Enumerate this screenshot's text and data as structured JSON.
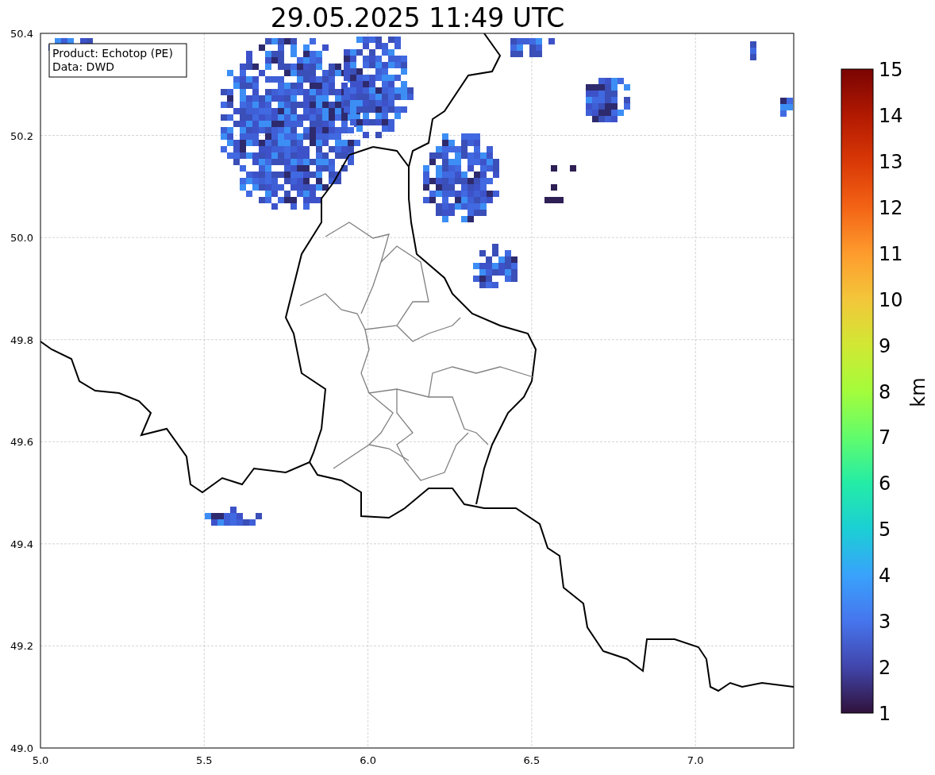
{
  "title": "29.05.2025 11:49 UTC",
  "info_box": [
    "Product: Echotop (PE)",
    "Data: DWD"
  ],
  "x_axis": {
    "ticks": [
      "5.0",
      "5.5",
      "6.0",
      "6.5",
      "7.0"
    ]
  },
  "y_axis": {
    "ticks": [
      "50.4",
      "50.2",
      "50.0",
      "49.8",
      "49.6",
      "49.4",
      "49.2",
      "49.0"
    ]
  },
  "colorbar": {
    "label": "km",
    "ticks": [
      "15",
      "14",
      "13",
      "12",
      "11",
      "10",
      "9",
      "8",
      "7",
      "6",
      "5",
      "4",
      "3",
      "2",
      "1"
    ]
  }
}
